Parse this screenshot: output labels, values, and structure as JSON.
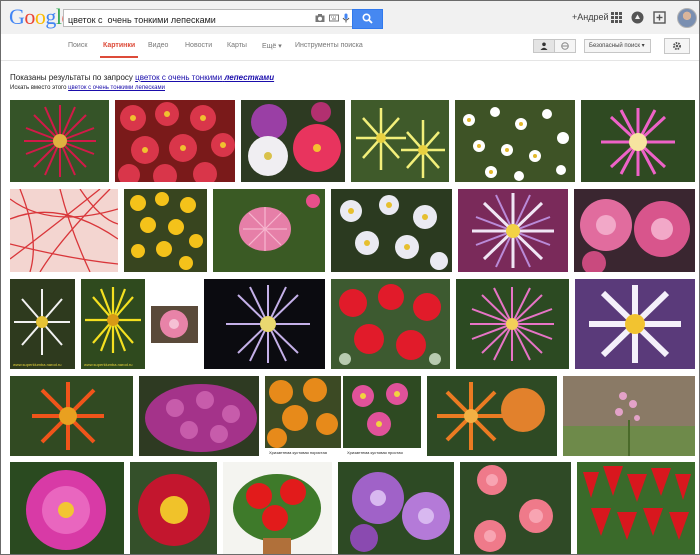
{
  "logo": {
    "text": "Google",
    "letters": [
      "G",
      "o",
      "o",
      "g",
      "l",
      "e"
    ]
  },
  "search": {
    "query": "цветок с  очень тонкими лепесками"
  },
  "header": {
    "user": "+Андрей"
  },
  "nav": {
    "tabs": [
      "Поиск",
      "Картинки",
      "Видео",
      "Новости",
      "Карты",
      "Ещё",
      "Инструменты поиска"
    ],
    "active_tab": "Картинки",
    "safe_search": "Безопасный поиск"
  },
  "results": {
    "showing_prefix": "Показаны результаты по запросу",
    "showing_query_plain": "цветок с очень тонкими",
    "showing_query_bold": "лепестками",
    "instead_prefix": "Искать вместо этого",
    "instead_query": "цветок с  очень тонкими лепесками"
  },
  "captions": {
    "thumb_watermark": "www.superklumba.narod.ru",
    "chrys_bush_left": "Хризантема кустовая пористая",
    "chrys_bush_right": "Хризантема кустовая простая"
  },
  "colors": {
    "accent": "#dd4b39",
    "link": "#1a0dab",
    "search_button": "#4688f1",
    "logo": [
      "#4285f4",
      "#ea4335",
      "#fbbc05",
      "#4285f4",
      "#34a853",
      "#ea4335"
    ]
  }
}
